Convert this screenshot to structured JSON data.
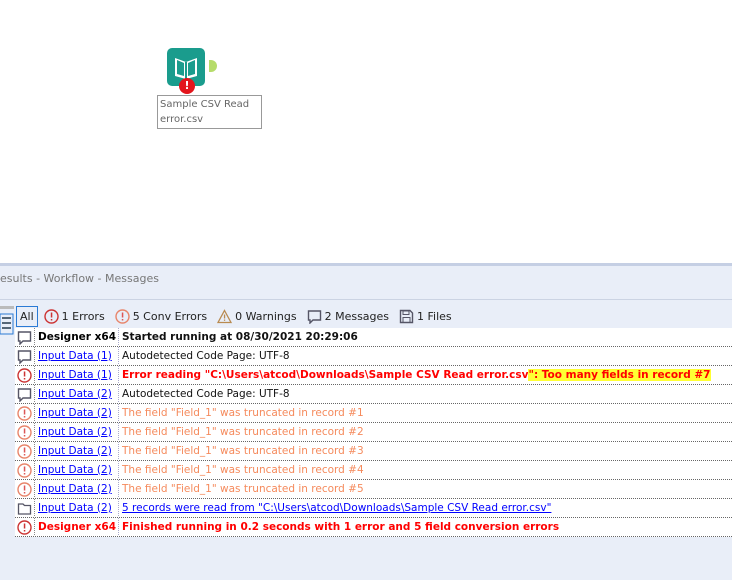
{
  "canvas": {
    "tool": {
      "label": "Sample CSV Read error.csv",
      "icon": "input-data-book-icon",
      "status": "error"
    }
  },
  "panel": {
    "title": "esults - Workflow - Messages",
    "filters": [
      {
        "label": "All",
        "icon": ""
      },
      {
        "label": "1 Errors",
        "icon": "error-icon"
      },
      {
        "label": "5 Conv Errors",
        "icon": "conv-error-icon"
      },
      {
        "label": "0 Warnings",
        "icon": "warning-icon"
      },
      {
        "label": "2 Messages",
        "icon": "message-icon"
      },
      {
        "label": "1 Files",
        "icon": "file-icon"
      }
    ],
    "rows": [
      {
        "icon": "message",
        "source": "Designer x64",
        "text": "Started running at 08/30/2021 20:29:06",
        "style": "bold"
      },
      {
        "icon": "message",
        "source": "Input Data (1)",
        "text": "Autodetected Code Page: UTF-8",
        "style": "normal"
      },
      {
        "icon": "error",
        "source": "Input Data (1)",
        "text": "Error reading \"C:\\Users\\atcod\\Downloads\\Sample CSV Read error.csv",
        "highlight": "\": Too many fields in record #7",
        "style": "error"
      },
      {
        "icon": "message",
        "source": "Input Data (2)",
        "text": "Autodetected Code Page: UTF-8",
        "style": "normal"
      },
      {
        "icon": "conv",
        "source": "Input Data (2)",
        "text": "The field \"Field_1\" was truncated in record #1",
        "style": "conv"
      },
      {
        "icon": "conv",
        "source": "Input Data (2)",
        "text": "The field \"Field_1\" was truncated in record #2",
        "style": "conv"
      },
      {
        "icon": "conv",
        "source": "Input Data (2)",
        "text": "The field \"Field_1\" was truncated in record #3",
        "style": "conv"
      },
      {
        "icon": "conv",
        "source": "Input Data (2)",
        "text": "The field \"Field_1\" was truncated in record #4",
        "style": "conv"
      },
      {
        "icon": "conv",
        "source": "Input Data (2)",
        "text": "The field \"Field_1\" was truncated in record #5",
        "style": "conv"
      },
      {
        "icon": "file",
        "source": "Input Data (2)",
        "text": "5 records were read from \"C:\\Users\\atcod\\Downloads\\Sample CSV Read error.csv\"",
        "style": "link"
      },
      {
        "icon": "error",
        "source": "Designer x64",
        "text": "Finished running in 0.2 seconds with 1 error and 5 field conversion errors",
        "style": "error-src"
      }
    ]
  },
  "colors": {
    "error": "#ff0000",
    "conv": "#f58a5c",
    "link": "#0000ff",
    "highlight": "#ffff33",
    "tool": "#1a9c8d"
  }
}
